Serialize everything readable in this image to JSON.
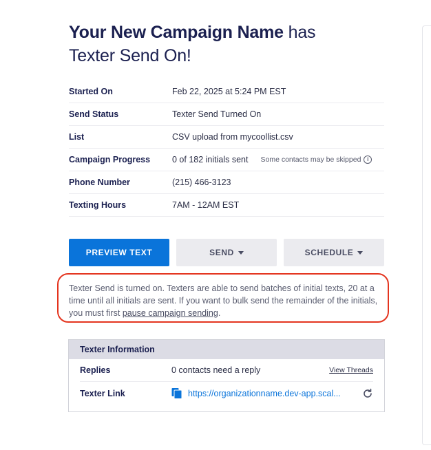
{
  "header": {
    "campaign_name": "Your New Campaign Name",
    "title_suffix_1": "has",
    "title_suffix_2": "Texter Send On!"
  },
  "details": [
    {
      "label": "Started On",
      "value": "Feb 22, 2025 at 5:24 PM EST"
    },
    {
      "label": "Send Status",
      "value": "Texter Send Turned On"
    },
    {
      "label": "List",
      "value": "CSV upload from mycoollist.csv"
    },
    {
      "label": "Campaign Progress",
      "value": "0 of 182 initials sent",
      "note": "Some contacts may be skipped"
    },
    {
      "label": "Phone Number",
      "value": "(215) 466-3123"
    },
    {
      "label": "Texting Hours",
      "value": "7AM - 12AM EST"
    }
  ],
  "buttons": {
    "preview": "PREVIEW TEXT",
    "send": "SEND",
    "schedule": "SCHEDULE"
  },
  "notice": {
    "text": "Texter Send is turned on. Texters are able to send batches of initial texts, 20 at a time until all initials are sent. If you want to bulk send the remainder of the initials, you must first",
    "link": "pause campaign sending",
    "end": "."
  },
  "texter_info": {
    "heading": "Texter Information",
    "replies_label": "Replies",
    "replies_value": "0 contacts need a reply",
    "view_threads": "View Threads",
    "link_label": "Texter Link",
    "link_url": "https://organizationname.dev-app.scal..."
  },
  "colors": {
    "primary": "#0a74da",
    "highlight": "#e4341e",
    "heading": "#1b2050"
  },
  "icons": [
    "info-icon",
    "caret-down-icon",
    "copy-document-icon",
    "refresh-icon"
  ]
}
